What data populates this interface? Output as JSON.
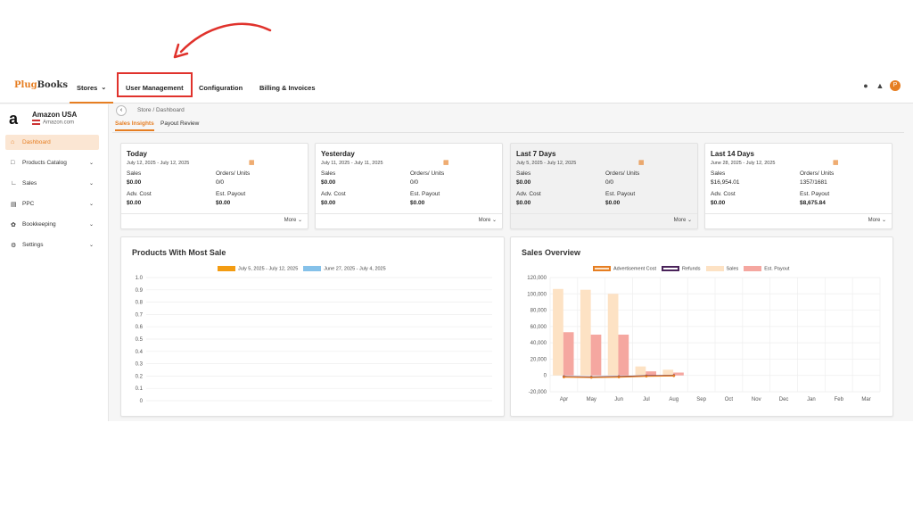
{
  "brand": {
    "logo": "PlugBooks",
    "logo_main": "Plug",
    "logo_tail": "Books"
  },
  "nav": {
    "stores": "Stores",
    "user_management": "User Management",
    "configuration": "Configuration",
    "billing": "Billing & Invoices",
    "avatar_initial": "P"
  },
  "store": {
    "name": "Amazon USA",
    "domain": "Amazon.com"
  },
  "sidebar": {
    "items": [
      {
        "label": "Dashboard",
        "icon": "home-icon",
        "active": true
      },
      {
        "label": "Products Catalog",
        "icon": "box-icon"
      },
      {
        "label": "Sales",
        "icon": "chart-icon"
      },
      {
        "label": "PPC",
        "icon": "ad-icon"
      },
      {
        "label": "Bookkeeping",
        "icon": "book-icon"
      },
      {
        "label": "Settings",
        "icon": "gear-icon"
      }
    ]
  },
  "breadcrumb": {
    "text": "Store  /  Dashboard"
  },
  "tabs": {
    "sales_insights": "Sales Insights",
    "payout_review": "Payout Review"
  },
  "cards": [
    {
      "title": "Today",
      "date": "July 12, 2025 - July 12, 2025",
      "sales_label": "Sales",
      "sales": "$0.00",
      "orders_label": "Orders/ Units",
      "orders": "0/0",
      "adv_label": "Adv. Cost",
      "adv": "$0.00",
      "payout_label": "Est. Payout",
      "payout": "$0.00",
      "more": "More"
    },
    {
      "title": "Yesterday",
      "date": "July 11, 2025 - July 11, 2025",
      "sales_label": "Sales",
      "sales": "$0.00",
      "orders_label": "Orders/ Units",
      "orders": "0/0",
      "adv_label": "Adv. Cost",
      "adv": "$0.00",
      "payout_label": "Est. Payout",
      "payout": "$0.00",
      "more": "More"
    },
    {
      "title": "Last 7 Days",
      "date": "July 5, 2025 - July 12, 2025",
      "sales_label": "Sales",
      "sales": "$0.00",
      "orders_label": "Orders/ Units",
      "orders": "0/0",
      "adv_label": "Adv. Cost",
      "adv": "$0.00",
      "payout_label": "Est. Payout",
      "payout": "$0.00",
      "more": "More"
    },
    {
      "title": "Last 14 Days",
      "date": "June 28, 2025 - July 12, 2025",
      "sales_label": "Sales",
      "sales": "$16,954.01",
      "orders_label": "Orders/ Units",
      "orders": "1357/1681",
      "adv_label": "Adv. Cost",
      "adv": "$0.00",
      "payout_label": "Est. Payout",
      "payout": "$8,675.84",
      "more": "More"
    }
  ],
  "colors": {
    "accent": "#e67e22",
    "highlight": "#e0322c"
  },
  "chart_data": [
    {
      "type": "bar",
      "title": "Products With Most Sale",
      "series": [
        {
          "name": "July 5, 2025 - July 12, 2025",
          "color": "#f39c12",
          "values": []
        },
        {
          "name": "June 27, 2025 - July 4, 2025",
          "color": "#85c1e9",
          "values": []
        }
      ],
      "ylim": [
        0,
        1
      ],
      "yticks": [
        "1.0",
        "0.9",
        "0.8",
        "0.7",
        "0.6",
        "0.5",
        "0.4",
        "0.3",
        "0.2",
        "0.1",
        "0"
      ],
      "legend": "top-center"
    },
    {
      "type": "bar",
      "title": "Sales Overview",
      "categories": [
        "Apr",
        "May",
        "Jun",
        "Jul",
        "Aug",
        "Sep",
        "Oct",
        "Nov",
        "Dec",
        "Jan",
        "Feb",
        "Mar"
      ],
      "yticks": [
        "120,000",
        "100,000",
        "80,000",
        "60,000",
        "40,000",
        "20,000",
        "0",
        "-20,000"
      ],
      "ylim": [
        -20000,
        120000
      ],
      "series": [
        {
          "name": "Advertisement Cost",
          "type": "line",
          "color": "#e67e22",
          "values": [
            -2000,
            -2500,
            -2000,
            -1000,
            -500,
            null,
            null,
            null,
            null,
            null,
            null,
            null
          ]
        },
        {
          "name": "Refunds",
          "type": "line",
          "color": "#4a235a",
          "values": [
            -1500,
            -2000,
            -1500,
            -500,
            0,
            null,
            null,
            null,
            null,
            null,
            null,
            null
          ]
        },
        {
          "name": "Sales",
          "type": "bar",
          "color": "#fde2c4",
          "values": [
            106000,
            105000,
            100000,
            11000,
            7000,
            null,
            null,
            null,
            null,
            null,
            null,
            null
          ]
        },
        {
          "name": "Est. Payout",
          "type": "bar",
          "color": "#f5a7a0",
          "values": [
            53000,
            50000,
            50000,
            5000,
            3500,
            null,
            null,
            null,
            null,
            null,
            null,
            null
          ]
        }
      ],
      "grid": true,
      "legend": "top-center"
    }
  ]
}
